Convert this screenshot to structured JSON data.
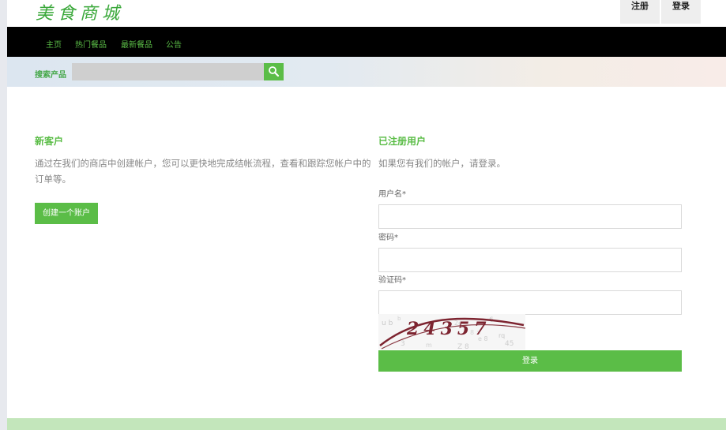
{
  "header": {
    "logo_text": "美食商城",
    "register_label": "注册",
    "login_label": "登录"
  },
  "nav": {
    "items": [
      {
        "label": "主页"
      },
      {
        "label": "热门餐品"
      },
      {
        "label": "最新餐品"
      },
      {
        "label": "公告"
      }
    ]
  },
  "search": {
    "label": "搜索产品",
    "value": "",
    "placeholder": "",
    "button_icon": "search-icon"
  },
  "new_customer": {
    "title": "新客户",
    "description": "通过在我们的商店中创建帐户，您可以更快地完成结帐流程，查看和跟踪您帐户中的订单等。",
    "button_label": "创建一个账户"
  },
  "registered": {
    "title": "已注册用户",
    "description": "如果您有我们的帐户，请登录。",
    "username_label": "用户名*",
    "username_value": "",
    "password_label": "密码*",
    "password_value": "",
    "captcha_label": "验证码*",
    "captcha_value": "",
    "captcha_text": "24357",
    "login_button": "登录"
  },
  "colors": {
    "accent": "#5bbd47",
    "nav_bg": "#000000",
    "footer_bg": "#c3e6bb"
  }
}
